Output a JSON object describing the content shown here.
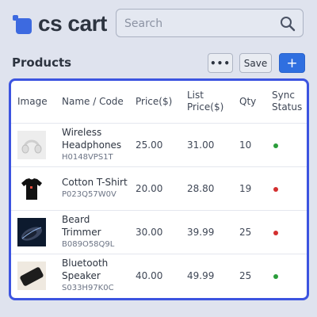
{
  "app": {
    "logo_text": "cs cart"
  },
  "search": {
    "placeholder": "Search",
    "value": ""
  },
  "page": {
    "title": "Products"
  },
  "toolbar": {
    "more_label": "•••",
    "save_label": "Save",
    "add_label": "+"
  },
  "table": {
    "columns": [
      "Image",
      "Name / Code",
      "Price($)",
      "List Price($)",
      "Qty",
      "Sync Status"
    ],
    "rows": [
      {
        "image_icon": "headphones-image",
        "name": "Wireless Headphones",
        "code": "H0148VPS1T",
        "price": "25.00",
        "list_price": "31.00",
        "qty": "10",
        "sync_status": "synced"
      },
      {
        "image_icon": "tshirt-image",
        "name": "Cotton T-Shirt",
        "code": "P023Q57W0V",
        "price": "20.00",
        "list_price": "28.80",
        "qty": "19",
        "sync_status": "not-synced"
      },
      {
        "image_icon": "trimmer-image",
        "name": "Beard Trimmer",
        "code": "B089O58Q9L",
        "price": "30.00",
        "list_price": "39.99",
        "qty": "25",
        "sync_status": "not-synced"
      },
      {
        "image_icon": "speaker-image",
        "name": "Bluetooth Speaker",
        "code": "S033H97K0C",
        "price": "40.00",
        "list_price": "49.99",
        "qty": "25",
        "sync_status": "synced"
      }
    ]
  },
  "colors": {
    "accent": "#2f6fe0",
    "synced": "#2a9d3a",
    "not_synced": "#d32f2f",
    "panel_border": "#3c54e0"
  }
}
